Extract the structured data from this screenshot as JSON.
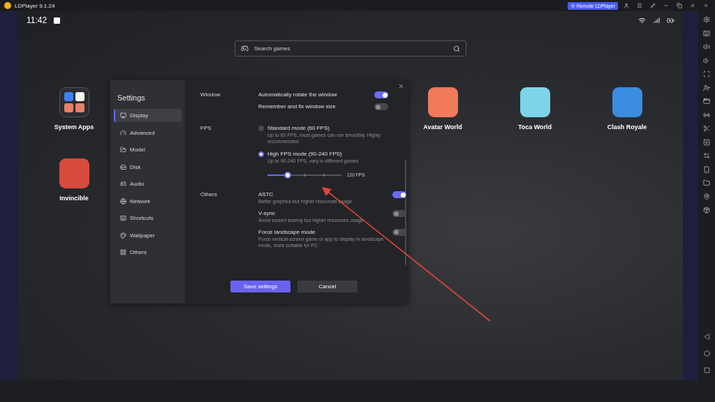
{
  "title_bar": {
    "app_title": "LDPlayer 9.1.24",
    "remote_button": "Remote LDPlayer"
  },
  "status_bar": {
    "time": "11:42"
  },
  "search": {
    "placeholder": "Search games"
  },
  "apps": [
    {
      "label": "System Apps",
      "kind": "folder"
    },
    {
      "label": "Avatar World",
      "kind": "app"
    },
    {
      "label": "Toca World",
      "kind": "app"
    },
    {
      "label": "Clash Royale",
      "kind": "app"
    },
    {
      "label": "Invincible",
      "kind": "app"
    }
  ],
  "settings": {
    "title": "Settings",
    "nav": [
      {
        "label": "Display",
        "selected": true
      },
      {
        "label": "Advanced",
        "selected": false
      },
      {
        "label": "Model",
        "selected": false
      },
      {
        "label": "Disk",
        "selected": false
      },
      {
        "label": "Audio",
        "selected": false
      },
      {
        "label": "Network",
        "selected": false
      },
      {
        "label": "Shortcuts",
        "selected": false
      },
      {
        "label": "Wallpaper",
        "selected": false
      },
      {
        "label": "Others",
        "selected": false
      }
    ],
    "sections": [
      {
        "label": "Window",
        "options": [
          {
            "kind": "toggle",
            "title": "Automatically rotate the window",
            "on": true
          },
          {
            "kind": "toggle",
            "title": "Remember and fix window size",
            "on": false
          }
        ]
      },
      {
        "label": "FPS",
        "options": [
          {
            "kind": "radio",
            "title": "Standard mode (60 FPS)",
            "description": "Up to 60 FPS, most games can run smoothly. Highly recommended.",
            "selected": false
          },
          {
            "kind": "radio",
            "title": "High FPS mode (90-240 FPS)",
            "description": "Up to 90-240 FPS, vary in different games",
            "selected": true
          },
          {
            "kind": "slider",
            "level": 0.27,
            "reading": "120 FPS"
          }
        ]
      },
      {
        "label": "Others",
        "options": [
          {
            "kind": "toggle",
            "title": "ASTC",
            "description": "Better graphics but higher resources usage",
            "on": true
          },
          {
            "kind": "toggle",
            "title": "V-sync",
            "description": "Avoid screen tearing but higher resources usage",
            "on": false
          },
          {
            "kind": "toggle",
            "title": "Force landscape mode",
            "description": "Force vertical-screen game or app to display in landscape mode, more suitable for PC",
            "on": false
          }
        ]
      }
    ],
    "buttons": [
      {
        "label": "Save settings",
        "kind": "primary"
      },
      {
        "label": "Cancel",
        "kind": "secondary"
      }
    ]
  }
}
